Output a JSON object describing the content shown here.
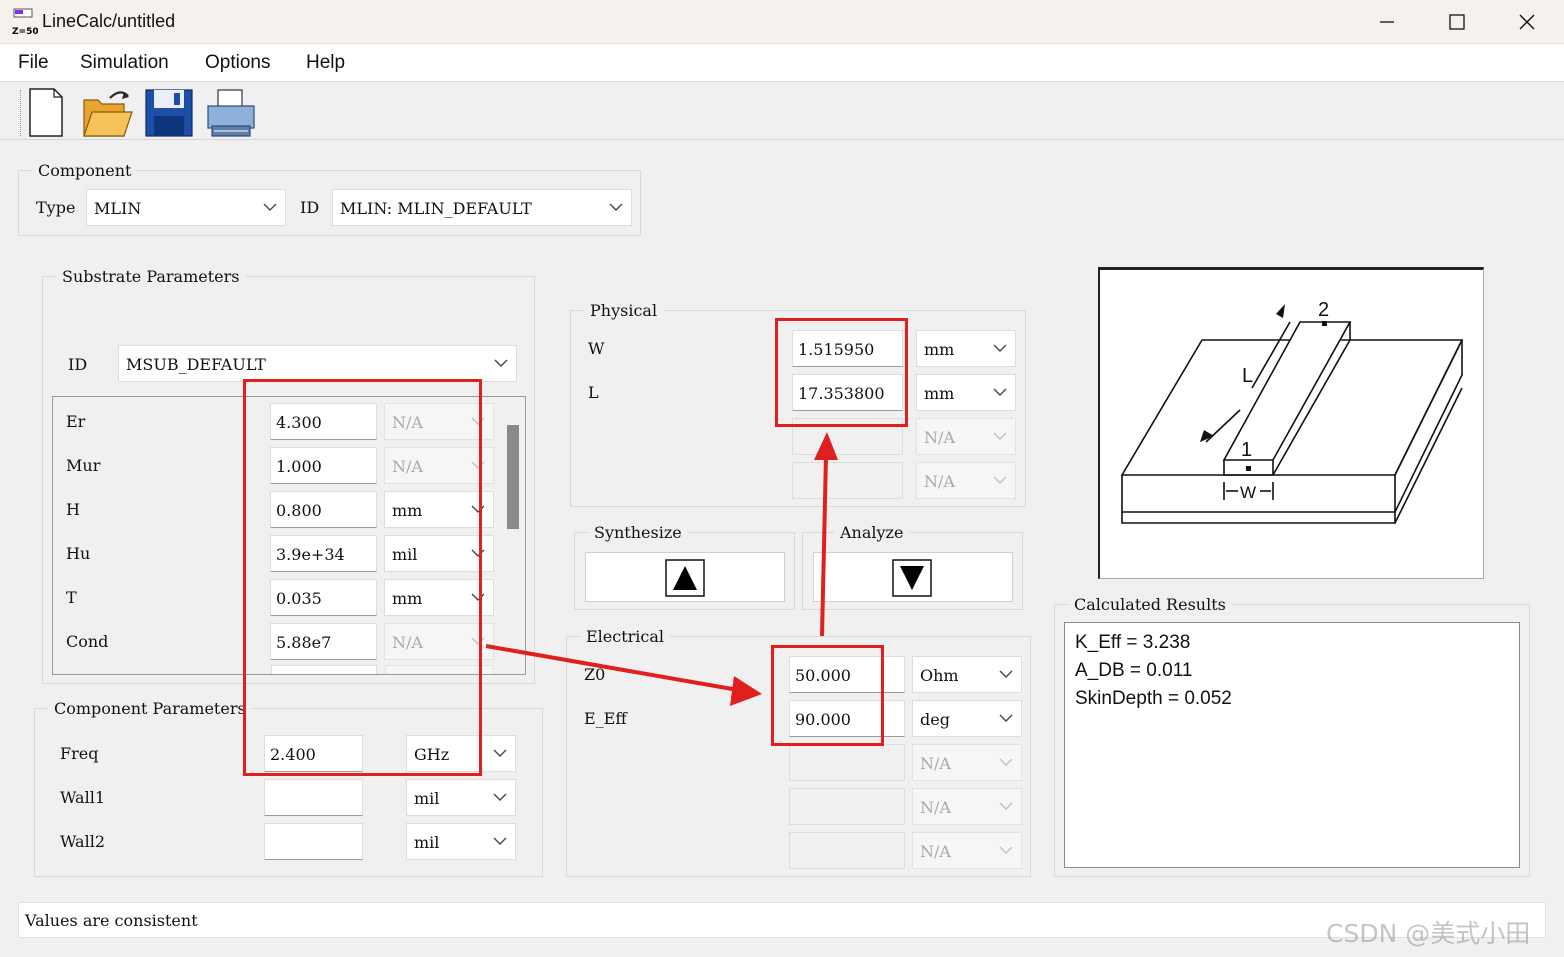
{
  "window": {
    "title": "LineCalc/untitled",
    "app_icon_text": "Z=50"
  },
  "menu": [
    "File",
    "Simulation",
    "Options",
    "Help"
  ],
  "toolbar": [
    "new-icon",
    "open-icon",
    "save-icon",
    "print-icon"
  ],
  "component": {
    "group_label": "Component",
    "type_label": "Type",
    "type_value": "MLIN",
    "id_label": "ID",
    "id_value": "MLIN: MLIN_DEFAULT"
  },
  "substrate": {
    "group_label": "Substrate Parameters",
    "id_label": "ID",
    "id_value": "MSUB_DEFAULT",
    "params": [
      {
        "name": "Er",
        "value": "4.300",
        "unit": "N/A",
        "enabled": false
      },
      {
        "name": "Mur",
        "value": "1.000",
        "unit": "N/A",
        "enabled": false
      },
      {
        "name": "H",
        "value": "0.800",
        "unit": "mm",
        "enabled": true
      },
      {
        "name": "Hu",
        "value": "3.9e+34",
        "unit": "mil",
        "enabled": true
      },
      {
        "name": "T",
        "value": "0.035",
        "unit": "mm",
        "enabled": true
      },
      {
        "name": "Cond",
        "value": "5.88e7",
        "unit": "N/A",
        "enabled": false
      }
    ]
  },
  "component_params": {
    "group_label": "Component Parameters",
    "rows": [
      {
        "name": "Freq",
        "value": "2.400",
        "unit": "GHz"
      },
      {
        "name": "Wall1",
        "value": "",
        "unit": "mil"
      },
      {
        "name": "Wall2",
        "value": "",
        "unit": "mil"
      }
    ]
  },
  "physical": {
    "group_label": "Physical",
    "rows": [
      {
        "name": "W",
        "value": "1.515950",
        "unit": "mm",
        "enabled": true
      },
      {
        "name": "L",
        "value": "17.353800",
        "unit": "mm",
        "enabled": true
      },
      {
        "name": "",
        "value": "",
        "unit": "N/A",
        "enabled": false
      },
      {
        "name": "",
        "value": "",
        "unit": "N/A",
        "enabled": false
      }
    ]
  },
  "synthesize": {
    "group_label": "Synthesize"
  },
  "analyze": {
    "group_label": "Analyze"
  },
  "electrical": {
    "group_label": "Electrical",
    "rows": [
      {
        "name": "Z0",
        "value": "50.000",
        "unit": "Ohm",
        "enabled": true
      },
      {
        "name": "E_Eff",
        "value": "90.000",
        "unit": "deg",
        "enabled": true
      },
      {
        "name": "",
        "value": "",
        "unit": "N/A",
        "enabled": false
      },
      {
        "name": "",
        "value": "",
        "unit": "N/A",
        "enabled": false
      },
      {
        "name": "",
        "value": "",
        "unit": "N/A",
        "enabled": false
      }
    ]
  },
  "diagram": {
    "label_1": "1",
    "label_2": "2",
    "label_L": "L",
    "label_W": "W"
  },
  "results": {
    "group_label": "Calculated Results",
    "lines": [
      "K_Eff = 3.238",
      "A_DB = 0.011",
      "SkinDepth = 0.052"
    ]
  },
  "status": "Values are consistent",
  "watermark": "CSDN @美式小田",
  "colors": {
    "annotation_red": "#e01f1f"
  }
}
